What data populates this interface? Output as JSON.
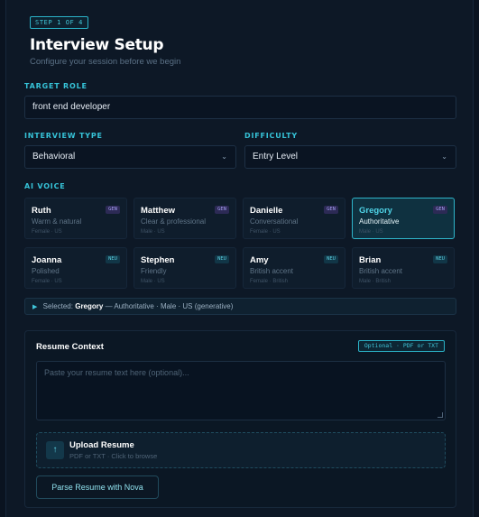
{
  "step": "STEP 1 OF 4",
  "title": "Interview Setup",
  "subtitle": "Configure your session before we begin",
  "target_role": {
    "label": "TARGET ROLE",
    "value": "front end developer"
  },
  "interview_type": {
    "label": "INTERVIEW TYPE",
    "value": "Behavioral"
  },
  "difficulty": {
    "label": "DIFFICULTY",
    "value": "Entry Level"
  },
  "select_arrow": "⌄",
  "ai_voice": {
    "label": "AI VOICE",
    "voices": [
      {
        "name": "Ruth",
        "desc": "Warm & natural",
        "meta": "Female · US",
        "tag": "GEN"
      },
      {
        "name": "Matthew",
        "desc": "Clear & professional",
        "meta": "Male · US",
        "tag": "GEN"
      },
      {
        "name": "Danielle",
        "desc": "Conversational",
        "meta": "Female · US",
        "tag": "GEN"
      },
      {
        "name": "Gregory",
        "desc": "Authoritative",
        "meta": "Male · US",
        "tag": "GEN",
        "selected": true
      },
      {
        "name": "Joanna",
        "desc": "Polished",
        "meta": "Female · US",
        "tag": "NEU"
      },
      {
        "name": "Stephen",
        "desc": "Friendly",
        "meta": "Male · US",
        "tag": "NEU"
      },
      {
        "name": "Amy",
        "desc": "British accent",
        "meta": "Female · British",
        "tag": "NEU"
      },
      {
        "name": "Brian",
        "desc": "British accent",
        "meta": "Male · British",
        "tag": "NEU"
      }
    ],
    "selected_prefix": "Selected:",
    "selected_name": "Gregory",
    "selected_rest": "— Authoritative · Male · US (generative)"
  },
  "resume": {
    "title": "Resume Context",
    "optional_tag": "Optional · PDF or TXT",
    "placeholder": "Paste your resume text here (optional)...",
    "upload_title": "Upload Resume",
    "upload_sub": "PDF or TXT · Click to browse",
    "upload_icon": "↑",
    "parse_button": "Parse Resume with Nova"
  },
  "colors": {
    "accent": "#36c3d8",
    "background": "#0d1826",
    "gen_tag": "#a49cf0"
  }
}
